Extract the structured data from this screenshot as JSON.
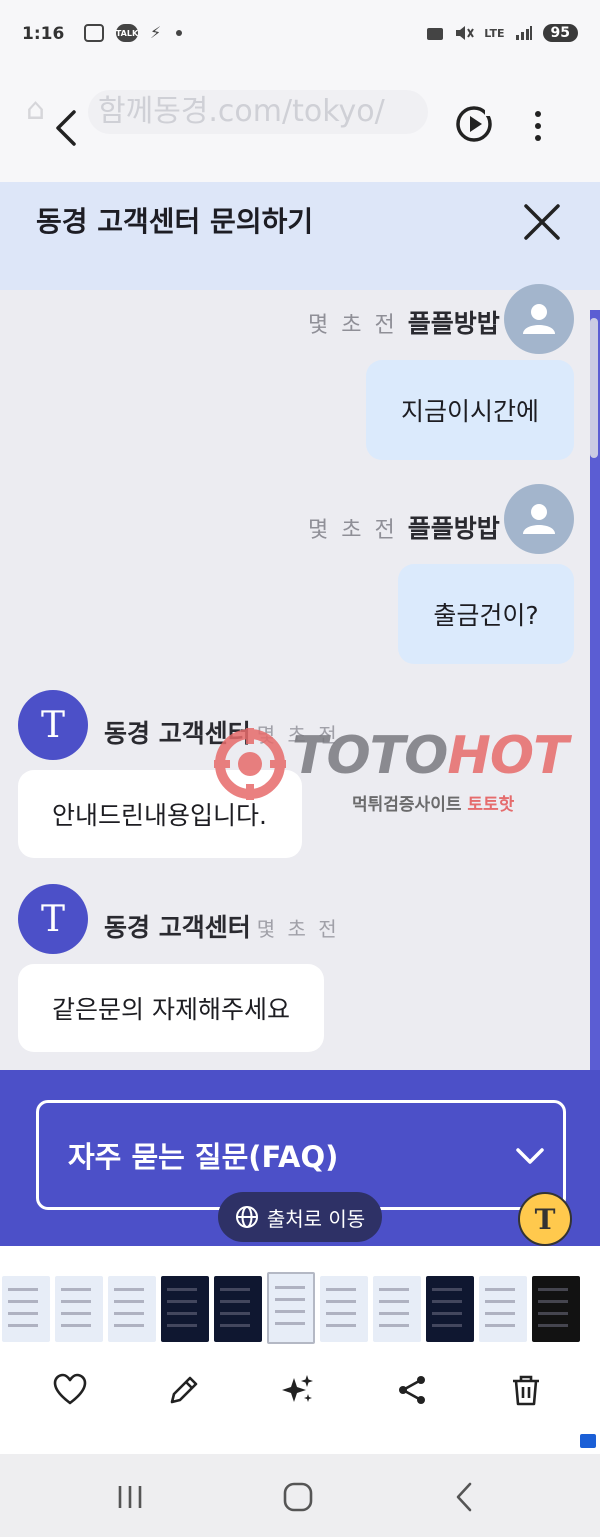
{
  "status_bar": {
    "time": "1:16",
    "talk_badge": "TALK",
    "network": "LTE",
    "battery": "95"
  },
  "browser": {
    "url_ghost": "함께동경.com/tokyo/"
  },
  "chat": {
    "title": "동경 고객센터 문의하기",
    "messages": [
      {
        "from": "user",
        "name": "플플방밥",
        "time": "몇 초 전",
        "text": "지금이시간에"
      },
      {
        "from": "user",
        "name": "플플방밥",
        "time": "몇 초 전",
        "text": "출금건이?"
      },
      {
        "from": "agent",
        "name": "동경 고객센터",
        "time": "몇 초 전",
        "avatar": "T",
        "text": "안내드린내용입니다."
      },
      {
        "from": "agent",
        "name": "동경 고객센터",
        "time": "몇 초 전",
        "avatar": "T",
        "text": "같은문의 자제해주세요"
      }
    ]
  },
  "watermark": {
    "brand_a": "TOTO",
    "brand_b": "HOT",
    "subtitle_a": "먹튀검증사이트",
    "subtitle_b": "토토핫"
  },
  "faq": {
    "label": "자주 묻는 질문(FAQ)"
  },
  "overlay": {
    "source_button": "출처로 이동",
    "lens_letter": "T"
  },
  "gallery": {
    "thumbnails": [
      "light",
      "light",
      "light",
      "dark",
      "dark",
      "light",
      "light",
      "light",
      "dark",
      "light",
      "black"
    ],
    "actions": [
      "favorite",
      "edit",
      "ai-effects",
      "share",
      "delete"
    ]
  },
  "colors": {
    "accent": "#4c50c8",
    "header_bg": "#dde6f8",
    "user_bubble": "#dbeafc",
    "agent_bubble": "#ffffff",
    "chat_bg": "#ececf1"
  }
}
